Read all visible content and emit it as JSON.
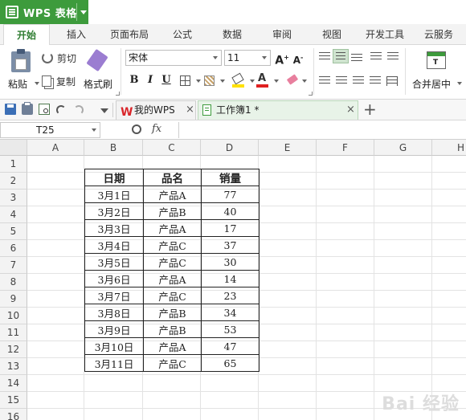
{
  "app": {
    "title": "WPS 表格"
  },
  "menu": {
    "tabs": [
      "开始",
      "插入",
      "页面布局",
      "公式",
      "数据",
      "审阅",
      "视图",
      "开发工具",
      "云服务"
    ]
  },
  "ribbon": {
    "paste": "粘贴",
    "cut": "剪切",
    "copy": "复制",
    "format_painter": "格式刷",
    "font_name": "宋体",
    "font_size": "11",
    "bold": "B",
    "italic": "I",
    "underline": "U",
    "merge_center": "合并居中"
  },
  "tabs": {
    "my_wps": "我的WPS",
    "workbook": "工作簿1 *"
  },
  "formula_bar": {
    "name_box": "T25",
    "fx": "fx"
  },
  "sheet": {
    "columns": [
      "A",
      "B",
      "C",
      "D",
      "E",
      "F",
      "G",
      "H"
    ],
    "rows": [
      "1",
      "2",
      "3",
      "4",
      "5",
      "6",
      "7",
      "8",
      "9",
      "10",
      "11",
      "12",
      "13",
      "14",
      "15",
      "16"
    ],
    "table_headers": [
      "日期",
      "品名",
      "销量"
    ],
    "table_rows": [
      [
        "3月1日",
        "产品A",
        "77"
      ],
      [
        "3月2日",
        "产品B",
        "40"
      ],
      [
        "3月3日",
        "产品A",
        "17"
      ],
      [
        "3月4日",
        "产品C",
        "37"
      ],
      [
        "3月5日",
        "产品C",
        "30"
      ],
      [
        "3月6日",
        "产品A",
        "14"
      ],
      [
        "3月7日",
        "产品C",
        "23"
      ],
      [
        "3月8日",
        "产品B",
        "34"
      ],
      [
        "3月9日",
        "产品B",
        "53"
      ],
      [
        "3月10日",
        "产品A",
        "47"
      ],
      [
        "3月11日",
        "产品C",
        "65"
      ]
    ]
  },
  "watermark": "Bai 经验"
}
